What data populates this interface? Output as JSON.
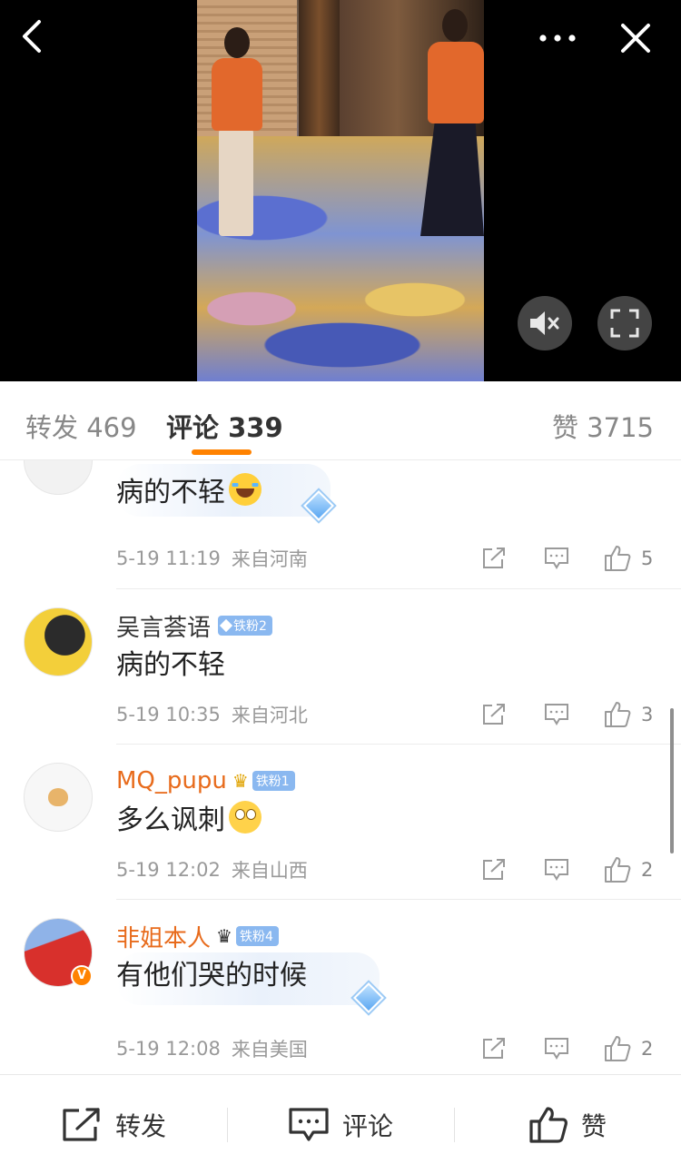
{
  "video": {
    "icons": {
      "back": "chevron-left-icon",
      "more": "more-dots-icon",
      "close": "close-icon",
      "mute": "speaker-mute-icon",
      "fullscreen": "fullscreen-icon"
    }
  },
  "tabs": {
    "repost": "转发 469",
    "comment": "评论 339",
    "like": "赞 3715"
  },
  "comments": [
    {
      "name": "",
      "text": "病的不轻",
      "emoji": "laugh-cry-emoji",
      "time": "5-19 11:19",
      "location": "来自河南",
      "likes": "5"
    },
    {
      "name": "吴言荟语",
      "badge": "铁粉2",
      "text": "病的不轻",
      "time": "5-19 10:35",
      "location": "来自河北",
      "likes": "3"
    },
    {
      "name": "MQ_pupu",
      "badge": "铁粉1",
      "text": "多么讽刺",
      "emoji": "eye-roll-emoji",
      "time": "5-19 12:02",
      "location": "来自山西",
      "likes": "2"
    },
    {
      "name": "非姐本人",
      "badge": "铁粉4",
      "text": "有他们哭的时候",
      "time": "5-19 12:08",
      "location": "来自美国",
      "likes": "2"
    }
  ],
  "bottom_bar": {
    "repost": "转发",
    "comment": "评论",
    "like": "赞"
  },
  "colors": {
    "accent": "#ff8200",
    "vip_name": "#e86b1c",
    "badge": "#8ab8f0",
    "meta": "#999999"
  }
}
